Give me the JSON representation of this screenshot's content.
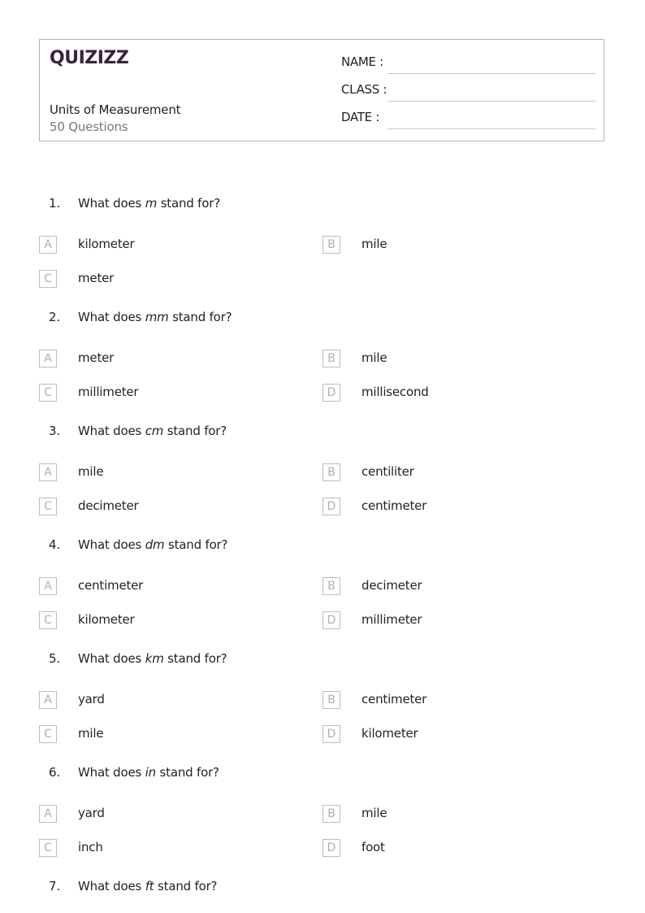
{
  "header": {
    "brand": "QUIZIZZ",
    "brand_color": "#3a2240",
    "title": "Units of Measurement",
    "question_count": "50 Questions",
    "fields": [
      {
        "label": "NAME :"
      },
      {
        "label": "CLASS :"
      },
      {
        "label": "DATE  :"
      }
    ]
  },
  "questions": [
    {
      "number": "1.",
      "prefix": "What does ",
      "term": "m",
      "suffix": " stand for?",
      "options": [
        {
          "letter": "A",
          "text": "kilometer"
        },
        {
          "letter": "B",
          "text": "mile"
        },
        {
          "letter": "C",
          "text": "meter"
        }
      ]
    },
    {
      "number": "2.",
      "prefix": "What does ",
      "term": "mm",
      "suffix": " stand for?",
      "options": [
        {
          "letter": "A",
          "text": "meter"
        },
        {
          "letter": "B",
          "text": "mile"
        },
        {
          "letter": "C",
          "text": "millimeter"
        },
        {
          "letter": "D",
          "text": "millisecond"
        }
      ]
    },
    {
      "number": "3.",
      "prefix": "What does ",
      "term": "cm",
      "suffix": " stand for?",
      "options": [
        {
          "letter": "A",
          "text": "mile"
        },
        {
          "letter": "B",
          "text": "centiliter"
        },
        {
          "letter": "C",
          "text": "decimeter"
        },
        {
          "letter": "D",
          "text": "centimeter"
        }
      ]
    },
    {
      "number": "4.",
      "prefix": "What does ",
      "term": "dm",
      "suffix": " stand for?",
      "options": [
        {
          "letter": "A",
          "text": "centimeter"
        },
        {
          "letter": "B",
          "text": "decimeter"
        },
        {
          "letter": "C",
          "text": "kilometer"
        },
        {
          "letter": "D",
          "text": "millimeter"
        }
      ]
    },
    {
      "number": "5.",
      "prefix": "What does ",
      "term": "km",
      "suffix": " stand for?",
      "options": [
        {
          "letter": "A",
          "text": "yard"
        },
        {
          "letter": "B",
          "text": "centimeter"
        },
        {
          "letter": "C",
          "text": "mile"
        },
        {
          "letter": "D",
          "text": "kilometer"
        }
      ]
    },
    {
      "number": "6.",
      "prefix": "What does ",
      "term": "in",
      "suffix": " stand for?",
      "options": [
        {
          "letter": "A",
          "text": "yard"
        },
        {
          "letter": "B",
          "text": "mile"
        },
        {
          "letter": "C",
          "text": "inch"
        },
        {
          "letter": "D",
          "text": "foot"
        }
      ]
    },
    {
      "number": "7.",
      "prefix": "What does ",
      "term": "ft",
      "suffix": " stand for?",
      "options": []
    }
  ]
}
